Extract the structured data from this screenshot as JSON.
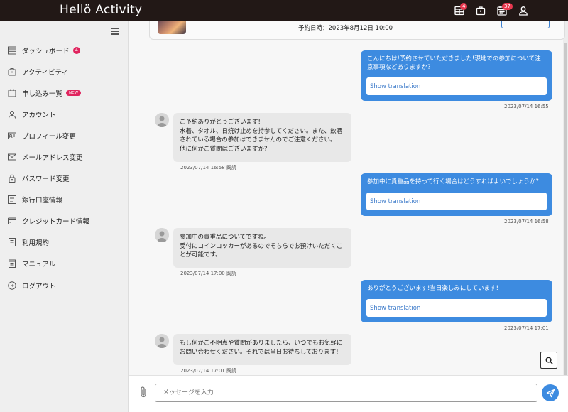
{
  "header": {
    "logo": "Hellö Activity",
    "icons": [
      {
        "name": "calendar-grid-icon",
        "badge": "4"
      },
      {
        "name": "bag-icon",
        "badge": ""
      },
      {
        "name": "calendar-icon",
        "badge": "37"
      },
      {
        "name": "user-icon",
        "badge": ""
      }
    ]
  },
  "sidebar": {
    "items": [
      {
        "label": "ダッシュボード",
        "icon": "table-icon",
        "badge": "4"
      },
      {
        "label": "アクティビティ",
        "icon": "briefcase-icon"
      },
      {
        "label": "申し込み一覧",
        "icon": "calendar-icon",
        "tag": "NEW"
      },
      {
        "label": "アカウント",
        "icon": "person-icon"
      },
      {
        "label": "プロフィール変更",
        "icon": "profile-card-icon"
      },
      {
        "label": "メールアドレス変更",
        "icon": "envelope-icon"
      },
      {
        "label": "パスワード変更",
        "icon": "lock-icon"
      },
      {
        "label": "銀行口座情報",
        "icon": "bank-icon"
      },
      {
        "label": "クレジットカード情報",
        "icon": "credit-card-icon"
      },
      {
        "label": "利用規約",
        "icon": "document-icon"
      },
      {
        "label": "マニュアル",
        "icon": "manual-icon"
      },
      {
        "label": "ログアウト",
        "icon": "logout-icon"
      }
    ]
  },
  "booking": {
    "date_text": "予約日時：2023年8月12日 10:00"
  },
  "messages": [
    {
      "direction": "out",
      "text": "こんにちは!予約させていただきました!現地での参加について注意事項などありますか?",
      "translate_label": "Show translation",
      "timestamp": "2023/07/14 16:55"
    },
    {
      "direction": "in",
      "lines": [
        "ご予約ありがとうございます!",
        "水着、タオル、日焼け止めを持参してください。また、飲酒",
        "されている場合の参加はできませんのでご注意ください。",
        "他に何かご質問はございますか?"
      ],
      "timestamp": "2023/07/14 16:58 既読"
    },
    {
      "direction": "out",
      "text": "参加中に貴重品を持って行く場合はどうすればよいでしょうか?",
      "translate_label": "Show translation",
      "timestamp": "2023/07/14 16:58"
    },
    {
      "direction": "in",
      "lines": [
        "参加中の貴重品についてですね。",
        "受付にコインロッカーがあるのでそちらでお預けいただくこ",
        "とが可能です。"
      ],
      "timestamp": "2023/07/14 17:00 既読"
    },
    {
      "direction": "out",
      "text": "ありがとうございます!当日楽しみにしています!",
      "translate_label": "Show translation",
      "timestamp": "2023/07/14 17:01"
    },
    {
      "direction": "in",
      "lines": [
        "もし何かご不明点や質問がありましたら、いつでもお気軽に",
        "お問い合わせください。それでは当日お待ちしております!"
      ],
      "timestamp": "2023/07/14 17:01 既読"
    }
  ],
  "composer": {
    "placeholder": "メッセージを入力"
  },
  "colors": {
    "topbar": "#221816",
    "accent": "#3d8be0",
    "badge": "#e0245e"
  }
}
